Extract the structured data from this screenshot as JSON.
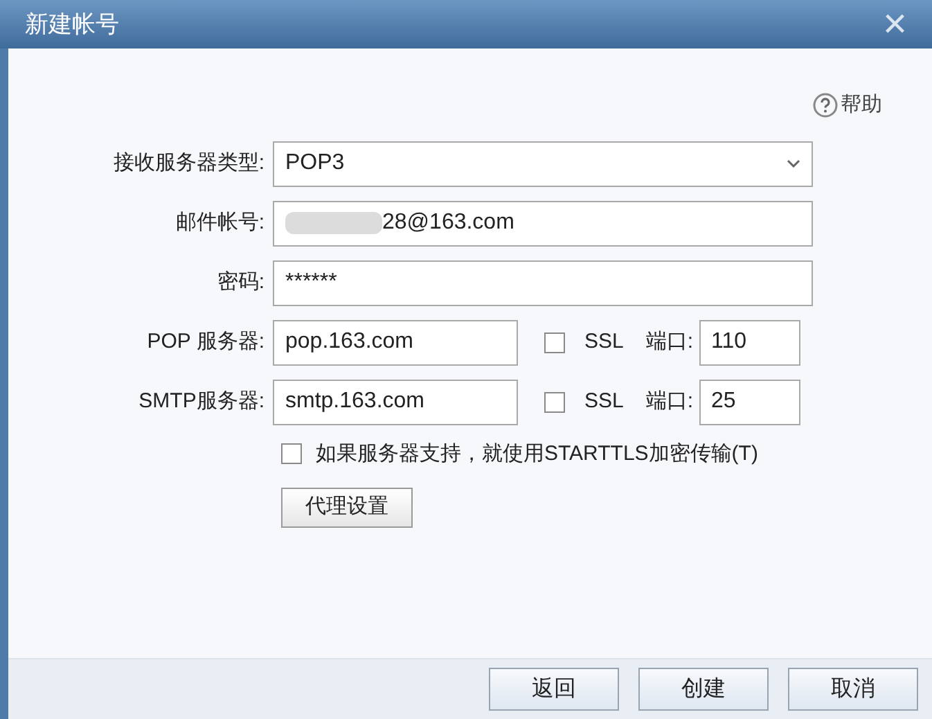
{
  "window": {
    "title": "新建帐号",
    "close": "×"
  },
  "help": "帮助",
  "fields": [
    {
      "kind": "select",
      "label": "接收服务器类型:",
      "value": "POP3"
    },
    {
      "kind": "blurred",
      "label": "邮件帐号:",
      "value": "28@163.com"
    },
    {
      "kind": "text",
      "label": "密码:",
      "value": "******"
    },
    {
      "kind": "server",
      "label": "POP 服务器:",
      "value": "pop.163.com",
      "ssl": {
        "label": "SSL",
        "checked": false
      },
      "port_label": "端口:",
      "port": "110"
    },
    {
      "kind": "server",
      "label": "SMTP服务器:",
      "value": "smtp.163.com",
      "ssl": {
        "label": "SSL",
        "checked": false
      },
      "port_label": "端口:",
      "port": "25"
    }
  ],
  "starttls": {
    "label": "如果服务器支持，就使用STARTTLS加密传输(T)",
    "checked": false
  },
  "proxy_button": "代理设置",
  "buttons": [
    "返回",
    "创建",
    "取消"
  ]
}
